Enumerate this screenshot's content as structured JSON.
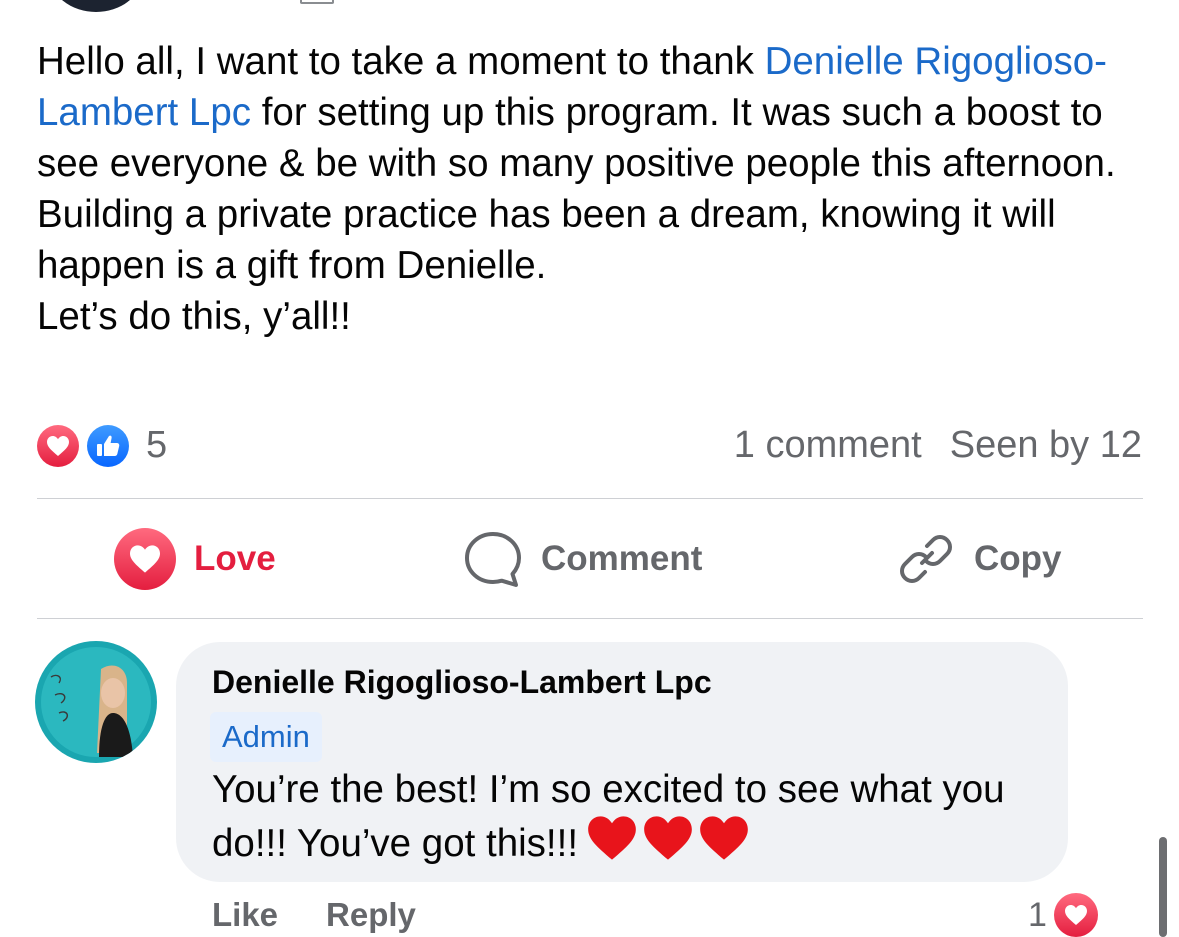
{
  "post": {
    "text_before_mention": "Hello all, I want to take a moment to thank ",
    "mention": "Denielle Rigoglioso-Lambert Lpc",
    "text_after_mention": " for setting up this program. It was such a boost to see everyone & be with so many positive people this afternoon. Building a private practice has been a dream, knowing it will happen is a gift from Denielle.\nLet’s do this, y’all!!"
  },
  "reactions": {
    "count": "5",
    "comments_label": "1 comment",
    "seen_label": "Seen by 12",
    "icons": [
      "love-icon",
      "like-icon"
    ]
  },
  "actions": {
    "love_label": "Love",
    "comment_label": "Comment",
    "copy_label": "Copy"
  },
  "comment": {
    "author": "Denielle Rigoglioso-Lambert Lpc",
    "badge": "Admin",
    "text": "You’re the best! I’m so excited to see what you do!!! You’ve got this!!!",
    "emoji": [
      "red-heart",
      "red-heart",
      "red-heart"
    ],
    "like_label": "Like",
    "reply_label": "Reply",
    "reaction_count": "1"
  },
  "colors": {
    "mention": "#1b6ac9",
    "love_red": "#e41e3f",
    "like_blue": "#0866ff",
    "muted": "#65676b",
    "bubble": "#f0f2f5"
  }
}
